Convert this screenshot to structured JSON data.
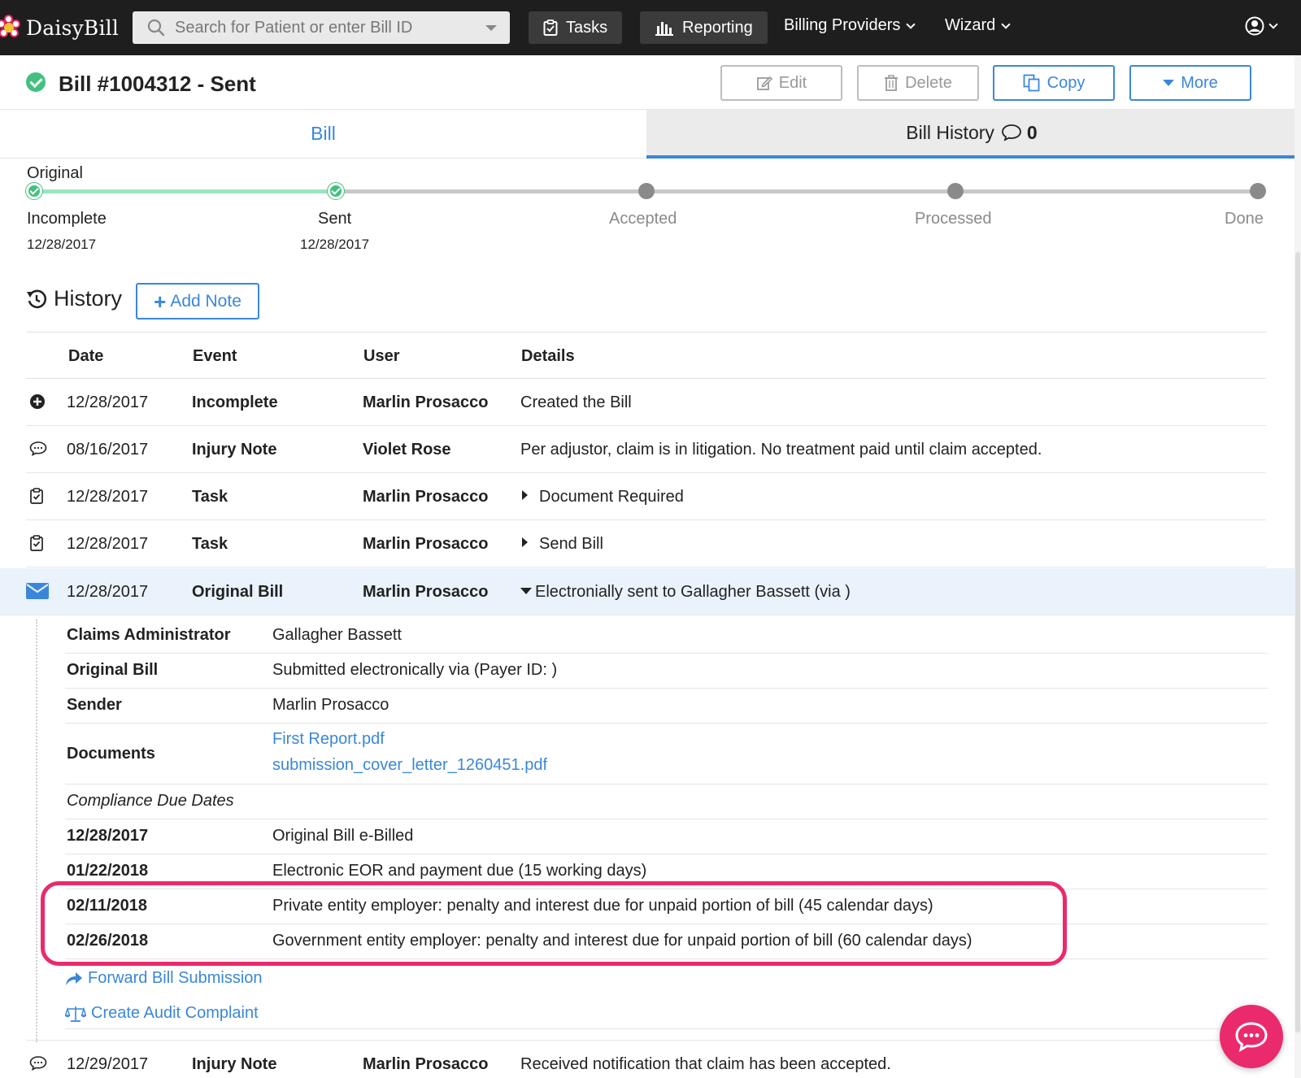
{
  "brand": {
    "name": "DaisyBill"
  },
  "search": {
    "placeholder": "Search for Patient or enter Bill ID"
  },
  "nav": {
    "tasks": "Tasks",
    "reporting": "Reporting",
    "billing_providers": "Billing Providers",
    "wizard": "Wizard"
  },
  "bill": {
    "title": "Bill #1004312 - Sent",
    "actions": {
      "edit": "Edit",
      "delete": "Delete",
      "copy": "Copy",
      "more": "More"
    }
  },
  "tabs": {
    "bill": "Bill",
    "history": "Bill History",
    "history_count": "0"
  },
  "progress": {
    "label": "Original",
    "steps": [
      {
        "name": "Incomplete",
        "date": "12/28/2017"
      },
      {
        "name": "Sent",
        "date": "12/28/2017"
      },
      {
        "name": "Accepted",
        "date": ""
      },
      {
        "name": "Processed",
        "date": ""
      },
      {
        "name": "Done",
        "date": ""
      }
    ]
  },
  "history": {
    "title": "History",
    "add_note": "Add Note",
    "columns": [
      "Date",
      "Event",
      "User",
      "Details"
    ],
    "rows": [
      {
        "icon": "plus-circle-icon",
        "date": "12/28/2017",
        "event": "Incomplete",
        "user": "Marlin Prosacco",
        "details": "Created the Bill"
      },
      {
        "icon": "comment-icon",
        "date": "08/16/2017",
        "event": "Injury Note",
        "user": "Violet Rose",
        "details": "Per adjustor, claim is in litigation. No treatment paid until claim accepted."
      },
      {
        "icon": "clipboard-check-icon",
        "date": "12/28/2017",
        "event": "Task",
        "user": "Marlin Prosacco",
        "details": "Document Required"
      },
      {
        "icon": "clipboard-check-icon",
        "date": "12/28/2017",
        "event": "Task",
        "user": "Marlin Prosacco",
        "details": "Send Bill"
      },
      {
        "icon": "envelope-icon",
        "date": "12/28/2017",
        "event": "Original Bill",
        "user": "Marlin Prosacco",
        "details": "Electronially sent to Gallagher Bassett (via )"
      }
    ],
    "expanded": {
      "claims_admin_label": "Claims Administrator",
      "claims_admin_value": "Gallagher Bassett",
      "original_bill_label": "Original Bill",
      "original_bill_value": "Submitted electronically via (Payer ID: )",
      "sender_label": "Sender",
      "sender_value": "Marlin Prosacco",
      "documents_label": "Documents",
      "documents": [
        "First Report.pdf",
        "submission_cover_letter_1260451.pdf"
      ],
      "compliance_label": "Compliance Due Dates",
      "compliance": [
        {
          "date": "12/28/2017",
          "text": "Original Bill e-Billed"
        },
        {
          "date": "01/22/2018",
          "text": "Electronic EOR and payment due (15 working days)"
        },
        {
          "date": "02/11/2018",
          "text": "Private entity employer: penalty and interest due for unpaid portion of bill (45 calendar days)"
        },
        {
          "date": "02/26/2018",
          "text": "Government entity employer: penalty and interest due for unpaid portion of bill (60 calendar days)"
        }
      ],
      "forward_link": "Forward Bill Submission",
      "audit_link": "Create Audit Complaint"
    },
    "last_row": {
      "icon": "comment-icon",
      "date": "12/29/2017",
      "event": "Injury Note",
      "user": "Marlin Prosacco",
      "details": "Received notification that claim has been accepted."
    }
  },
  "colors": {
    "accent": "#3a87d9",
    "success": "#43c07f",
    "highlight": "#ea2a6c",
    "nav_bg": "#1e1e1e"
  }
}
